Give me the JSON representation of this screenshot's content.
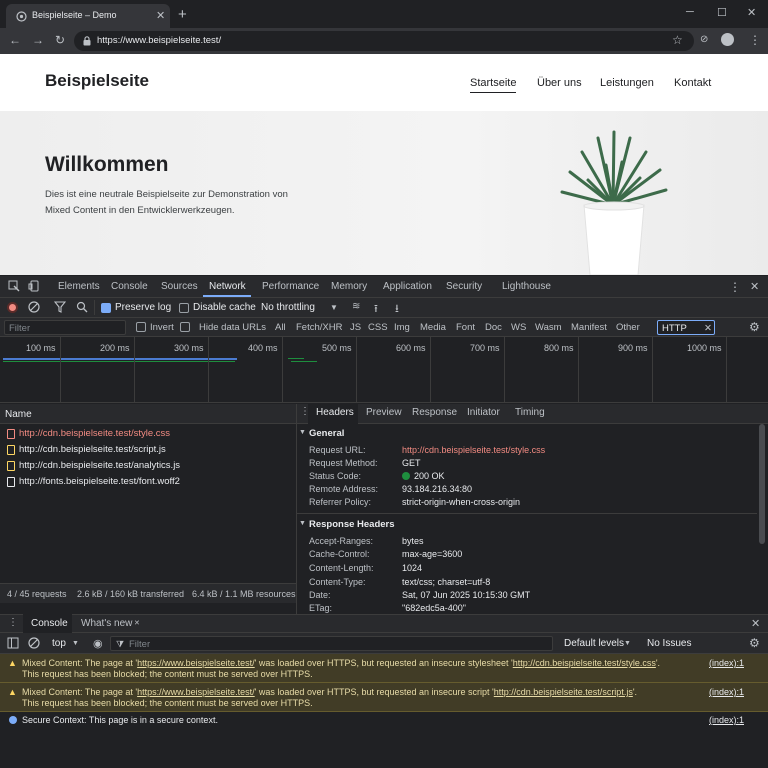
{
  "browser": {
    "tab_title": "Beispielseite – Demo",
    "new_tab": "+",
    "url": "https://www.beispielseite.test/",
    "window_controls": {
      "minimize": "─",
      "maximize": "☐",
      "close": "✕"
    }
  },
  "site": {
    "logo": "Beispielseite",
    "nav": [
      "Startseite",
      "Über uns",
      "Leistungen",
      "Kontakt"
    ],
    "hero_title": "Willkommen",
    "hero_text_1": "Dies ist eine neutrale Beispielseite zur Demonstration von",
    "hero_text_2": "Mixed Content in den Entwicklerwerkzeugen."
  },
  "devtools": {
    "tabs": [
      "Elements",
      "Console",
      "Sources",
      "Network",
      "Performance",
      "Memory",
      "Application",
      "Security",
      "Lighthouse"
    ],
    "active_tab": "Network",
    "network_bar": {
      "preserve_log": "Preserve log",
      "disable_cache": "Disable cache",
      "throttling": "No throttling"
    },
    "filter": {
      "placeholder": "Filter",
      "invert": "Invert",
      "hide_data_urls": "Hide data URLs",
      "types": [
        "All",
        "Fetch/XHR",
        "JS",
        "CSS",
        "Img",
        "Media",
        "Font",
        "Doc",
        "WS",
        "Wasm",
        "Manifest",
        "Other"
      ],
      "text_filter": "HTTP"
    },
    "timeline_labels": [
      "100 ms",
      "200 ms",
      "300 ms",
      "400 ms",
      "500 ms",
      "600 ms",
      "700 ms",
      "800 ms",
      "900 ms",
      "1000 ms"
    ],
    "requests_header": "Name",
    "requests": [
      {
        "name": "http://cdn.beispielseite.test/style.css",
        "blocked": true
      },
      {
        "name": "http://cdn.beispielseite.test/script.js",
        "blocked": false
      },
      {
        "name": "http://cdn.beispielseite.test/analytics.js",
        "blocked": false
      },
      {
        "name": "http://fonts.beispielseite.test/font.woff2",
        "blocked": false
      }
    ],
    "status_bar": {
      "requests": "4 / 45 requests",
      "transferred": "2.6 kB / 160 kB transferred",
      "resources": "6.4 kB / 1.1 MB resources"
    },
    "detail_tabs": [
      "Headers",
      "Preview",
      "Response",
      "Initiator",
      "Timing"
    ],
    "general_title": "General",
    "general": [
      {
        "k": "Request URL:",
        "v": "http://cdn.beispielseite.test/style.css"
      },
      {
        "k": "Request Method:",
        "v": "GET"
      },
      {
        "k": "Status Code:",
        "v": "200 OK"
      },
      {
        "k": "Remote Address:",
        "v": "93.184.216.34:80"
      },
      {
        "k": "Referrer Policy:",
        "v": "strict-origin-when-cross-origin"
      }
    ],
    "response_title": "Response Headers",
    "response": [
      {
        "k": "Accept-Ranges:",
        "v": "bytes"
      },
      {
        "k": "Cache-Control:",
        "v": "max-age=3600"
      },
      {
        "k": "Content-Length:",
        "v": "1024"
      },
      {
        "k": "Content-Type:",
        "v": "text/css; charset=utf-8"
      },
      {
        "k": "Date:",
        "v": "Sat, 07 Jun 2025 10:15:30 GMT"
      },
      {
        "k": "ETag:",
        "v": "\"682edc5a-400\""
      }
    ],
    "colors": {
      "accent": "#7cacf8",
      "error": "#f28b82",
      "success": "#1e8e3e",
      "warning": "#fdd663"
    }
  },
  "console": {
    "tabs": [
      "Console",
      "What's new"
    ],
    "context": "top",
    "filter_placeholder": "Filter",
    "levels": "Default levels",
    "issues": "No Issues",
    "messages": [
      {
        "a": "Mixed Content: The page at '",
        "l1": "https://www.beispielseite.test/",
        "b": "' was loaded over HTTPS, but requested an insecure stylesheet '",
        "l2": "http://cdn.beispielseite.test/style.css",
        "c": "'.",
        "line2": "This request has been blocked; the content must be served over HTTPS.",
        "src": "(index):1"
      },
      {
        "a": "Mixed Content: The page at '",
        "l1": "https://www.beispielseite.test/",
        "b": "' was loaded over HTTPS, but requested an insecure script '",
        "l2": "http://cdn.beispielseite.test/script.js",
        "c": "'.",
        "line2": "This request has been blocked; the content must be served over HTTPS.",
        "src": "(index):1"
      }
    ],
    "info": {
      "text": "Secure Context: This page is in a secure context.",
      "src": "(index):1"
    }
  }
}
